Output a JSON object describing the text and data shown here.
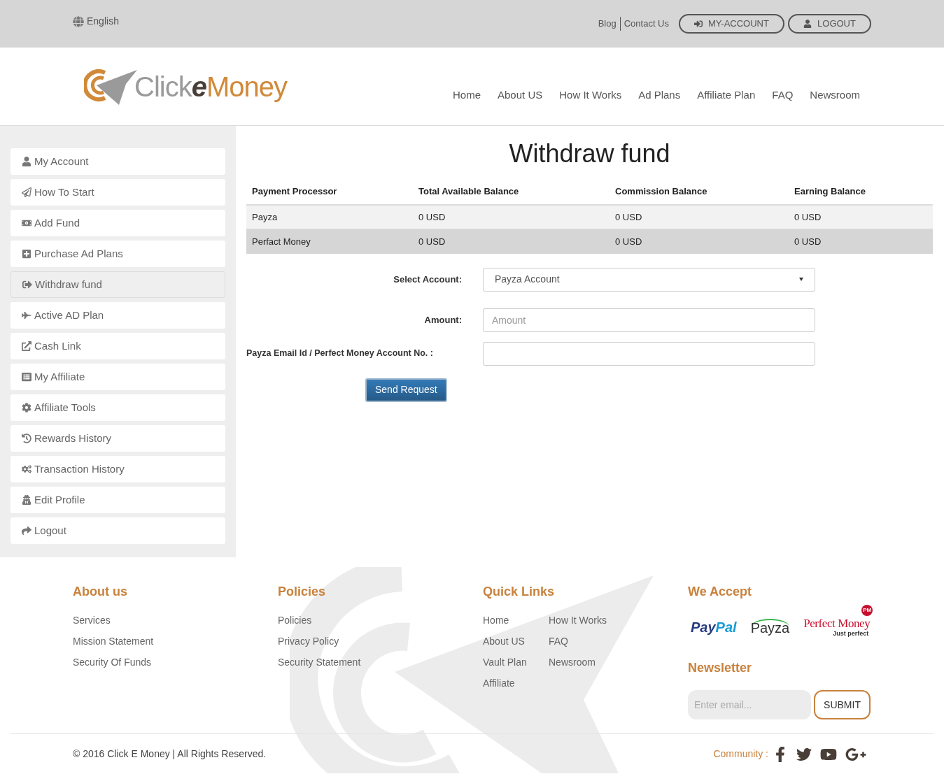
{
  "top_bar": {
    "language": "English",
    "links": [
      "Blog",
      "Contact Us"
    ],
    "buttons": [
      "MY-ACCOUNT",
      "LOGOUT"
    ]
  },
  "logo": {
    "word_1": "Click",
    "word_2": "e",
    "word_3": "Money"
  },
  "nav": [
    {
      "label": "Home"
    },
    {
      "label": "About US"
    },
    {
      "label": "How It Works"
    },
    {
      "label": "Ad Plans"
    },
    {
      "label": "Affiliate Plan"
    },
    {
      "label": "FAQ"
    },
    {
      "label": "Newsroom"
    }
  ],
  "sidebar": {
    "items": [
      {
        "label": "My Account",
        "selected": false
      },
      {
        "label": "How To Start",
        "selected": false
      },
      {
        "label": "Add Fund",
        "selected": false
      },
      {
        "label": "Purchase Ad Plans",
        "selected": false
      },
      {
        "label": "Withdraw fund",
        "selected": true
      },
      {
        "label": "Active AD Plan",
        "selected": false
      },
      {
        "label": "Cash Link",
        "selected": false
      },
      {
        "label": "My Affiliate",
        "selected": false
      },
      {
        "label": "Affiliate Tools",
        "selected": false
      },
      {
        "label": "Rewards History",
        "selected": false
      },
      {
        "label": "Transaction History",
        "selected": false
      },
      {
        "label": "Edit Profile",
        "selected": false
      },
      {
        "label": "Logout",
        "selected": false
      }
    ]
  },
  "page_title": "Withdraw fund",
  "table": {
    "columns": [
      "Payment Processor",
      "Total Available Balance",
      "Commission Balance",
      "Earning Balance"
    ],
    "rows": [
      [
        "Payza",
        "0 USD",
        "0 USD",
        "0 USD"
      ],
      [
        "Perfact Money",
        "0 USD",
        "0 USD",
        "0 USD"
      ]
    ]
  },
  "form": {
    "select_account": {
      "label": "Select Account:",
      "value": "Payza Account"
    },
    "amount": {
      "label": "Amount:",
      "placeholder": "Amount"
    },
    "account_no": {
      "label": "Payza Email Id / Perfect Money Account No. :"
    },
    "submit": "Send Request"
  },
  "footer": {
    "about": {
      "title": "About us",
      "links": [
        "Services",
        "Mission Statement",
        "Security Of Funds"
      ]
    },
    "policies": {
      "title": "Policies",
      "links": [
        "Policies",
        "Privacy Policy",
        "Security Statement"
      ]
    },
    "quick_links": {
      "title": "Quick Links",
      "links": [
        "Home",
        "How It Works",
        "About US",
        "FAQ",
        "Vault Plan",
        "Newsroom",
        "Affiliate"
      ]
    },
    "we_accept": {
      "title": "We Accept",
      "paypal": [
        "Pay",
        "Pal"
      ],
      "payza": "Payza",
      "perfect_money": "Perfect Money",
      "perfect_money_tagline": "Just perfect",
      "perfect_money_badge": "PM"
    },
    "newsletter": {
      "title": "Newsletter",
      "placeholder": "Enter email...",
      "button": "SUBMIT"
    },
    "copyright": "© 2016 Click E Money | All Rights Reserved.",
    "community": "Community :"
  }
}
